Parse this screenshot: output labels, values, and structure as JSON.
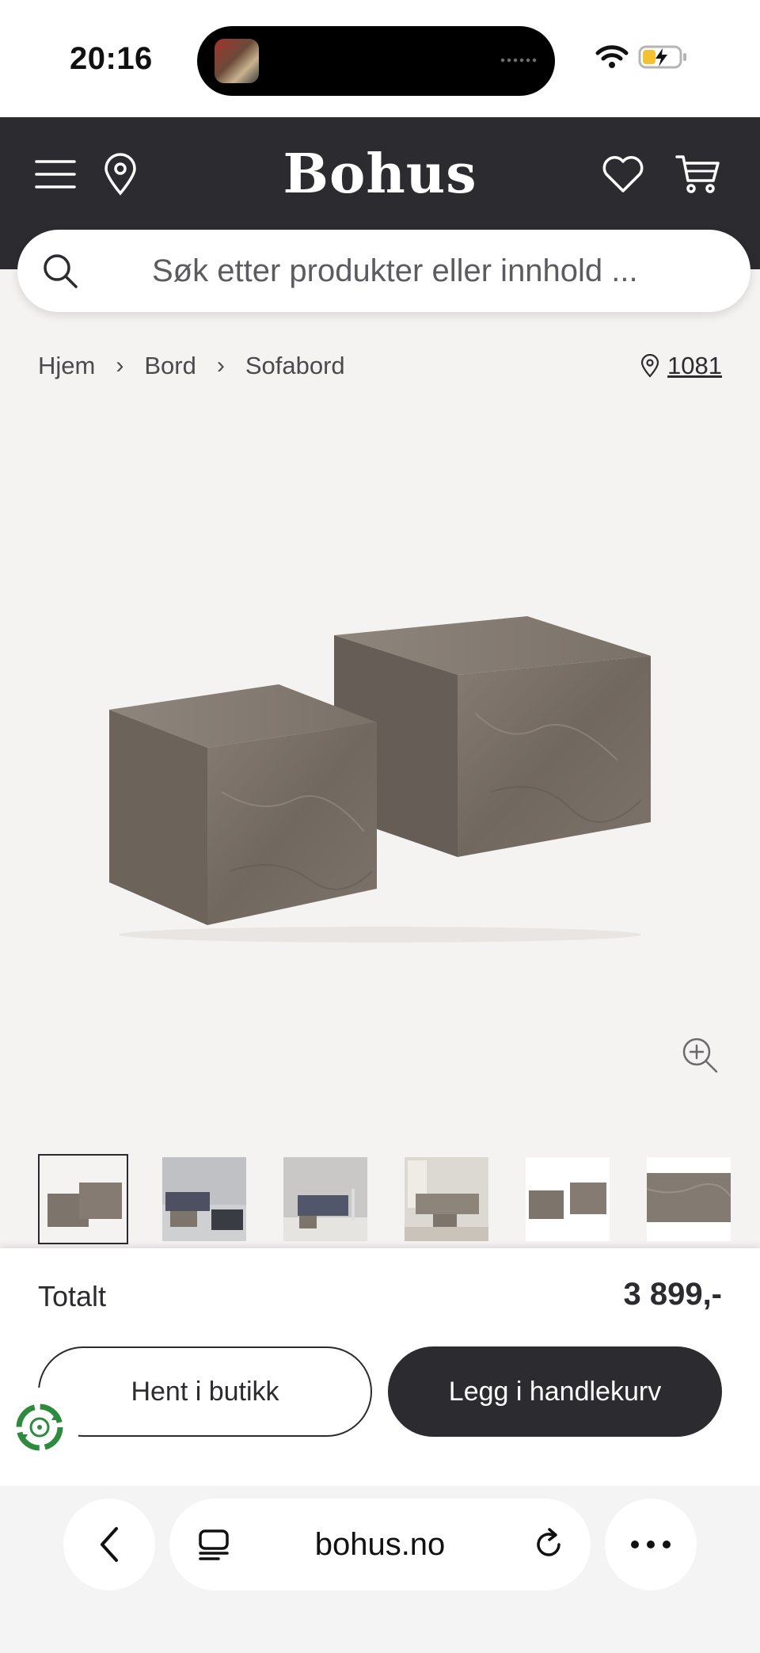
{
  "status_bar": {
    "time": "20:16"
  },
  "header": {
    "logo": "Bohus"
  },
  "search": {
    "placeholder": "Søk etter produkter eller innhold ..."
  },
  "breadcrumb": {
    "items": [
      "Hjem",
      "Bord",
      "Sofabord"
    ]
  },
  "store": {
    "number": "1081"
  },
  "product": {
    "thumbnails": [
      "thumb-1",
      "thumb-2",
      "thumb-3",
      "thumb-4",
      "thumb-5",
      "thumb-6"
    ],
    "active_thumbnail": 0
  },
  "purchase": {
    "total_label": "Totalt",
    "total_price": "3 899,-",
    "pickup_label": "Hent i butikk",
    "add_to_cart_label": "Legg i handlekurv"
  },
  "browser": {
    "url": "bohus.no"
  },
  "colors": {
    "header": "#2c2c30",
    "background": "#f5f3f2",
    "primary_button": "#2c2c30",
    "eco_badge": "#2d8a3e"
  }
}
